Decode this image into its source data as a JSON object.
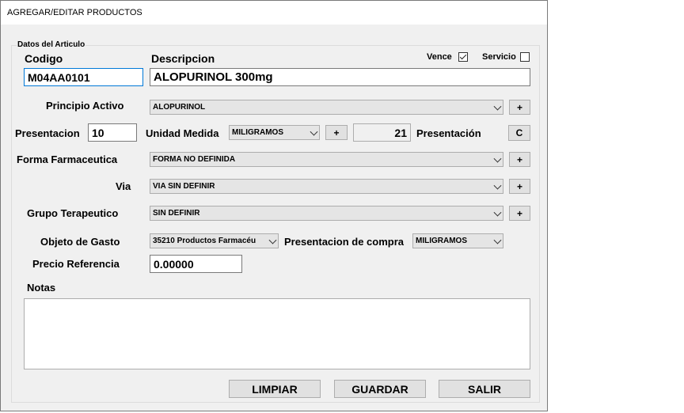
{
  "window": {
    "title": "AGREGAR/EDITAR PRODUCTOS"
  },
  "group": {
    "legend": "Datos del Articulo"
  },
  "codigo": {
    "label": "Codigo",
    "value": "M04AA0101"
  },
  "descripcion": {
    "label": "Descripcion",
    "value": "ALOPURINOL 300mg"
  },
  "vence": {
    "label": "Vence",
    "checked": true
  },
  "servicio": {
    "label": "Servicio",
    "checked": false
  },
  "principio_activo": {
    "label": "Principio Activo",
    "value": "ALOPURINOL",
    "add_label": "+"
  },
  "presentacion": {
    "label": "Presentacion",
    "value": "10",
    "unidad_label": "Unidad Medida",
    "unidad_value": "MILIGRAMOS",
    "add_label": "+",
    "computed_value": "21",
    "computed_label": "Presentación",
    "c_label": "C"
  },
  "forma_farmaceutica": {
    "label": "Forma Farmaceutica",
    "value": "FORMA NO DEFINIDA",
    "add_label": "+"
  },
  "via": {
    "label": "Via",
    "value": "VIA SIN DEFINIR",
    "add_label": "+"
  },
  "grupo_terapeutico": {
    "label": "Grupo Terapeutico",
    "value": "SIN DEFINIR",
    "add_label": "+"
  },
  "objeto_gasto": {
    "label": "Objeto de Gasto",
    "value": "35210 Productos Farmacéu"
  },
  "presentacion_compra": {
    "label": "Presentacion de compra",
    "value": "MILIGRAMOS"
  },
  "precio_referencia": {
    "label": "Precio Referencia",
    "value": "0.00000"
  },
  "notas": {
    "label": "Notas",
    "value": ""
  },
  "buttons": {
    "limpiar": "LIMPIAR",
    "guardar": "GUARDAR",
    "salir": "SALIR"
  }
}
